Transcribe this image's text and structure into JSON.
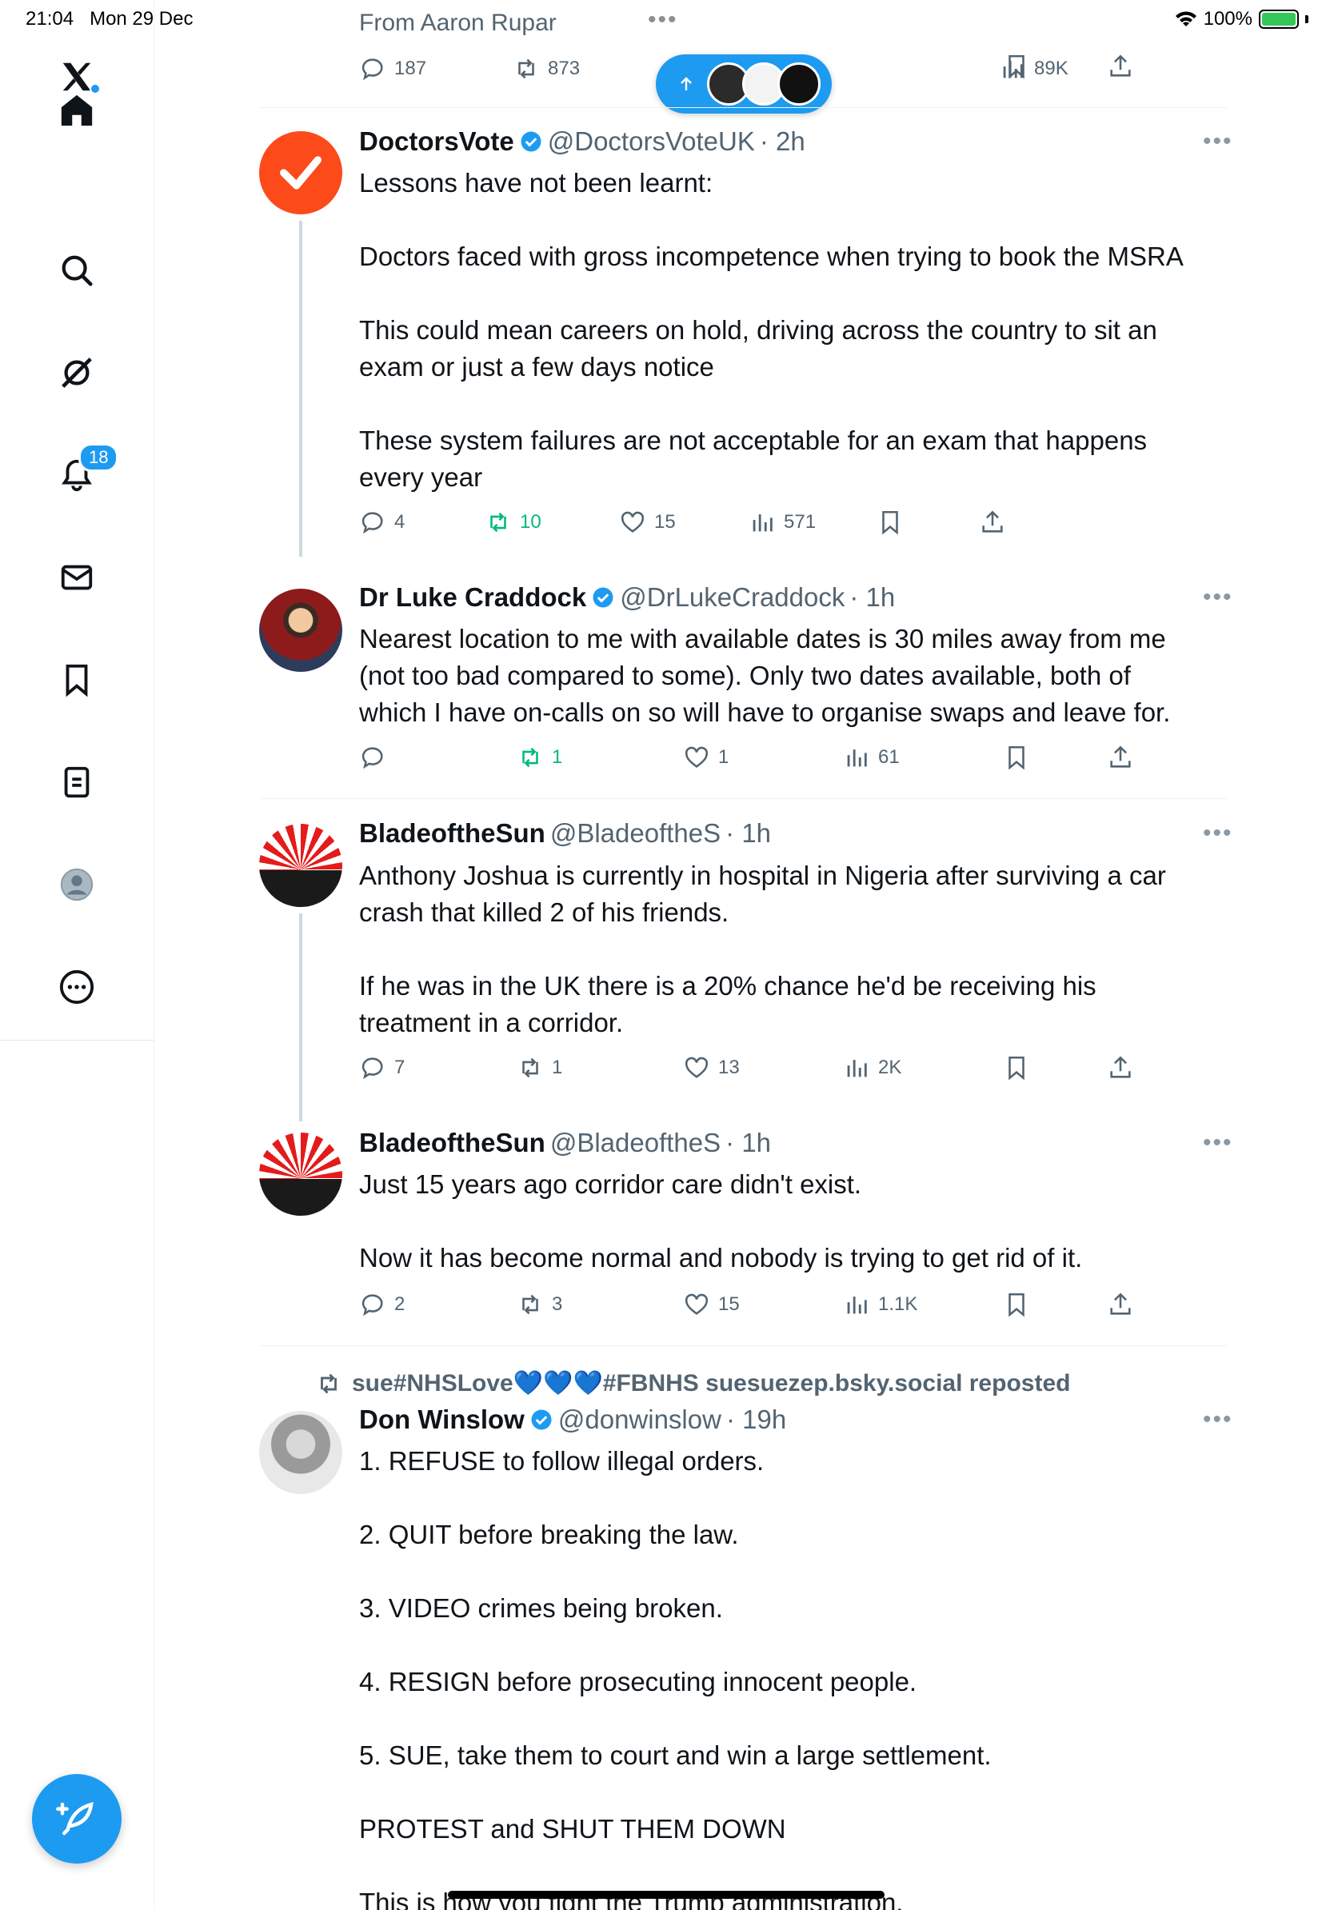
{
  "status_bar": {
    "time": "21:04",
    "date": "Mon 29 Dec",
    "battery": "100%"
  },
  "colors": {
    "accent": "#1d9bf0",
    "repost_active": "#00ba7c",
    "text_secondary": "#536471"
  },
  "sidebar": {
    "logo": "X",
    "items": [
      {
        "icon": "home-icon",
        "label": "Home"
      },
      {
        "icon": "search-icon",
        "label": "Explore"
      },
      {
        "icon": "grok-icon",
        "label": "Grok"
      },
      {
        "icon": "bell-icon",
        "label": "Notifications",
        "badge": "18"
      },
      {
        "icon": "mail-icon",
        "label": "Messages"
      },
      {
        "icon": "bookmark-icon",
        "label": "Bookmarks"
      },
      {
        "icon": "list-icon",
        "label": "Lists"
      },
      {
        "icon": "profile-icon",
        "label": "Profile"
      },
      {
        "icon": "more-icon",
        "label": "More"
      }
    ]
  },
  "top_post": {
    "from_label": "From Aaron Rupar",
    "replies": "187",
    "reposts": "873",
    "views": "89K"
  },
  "tweets": [
    {
      "name": "DoctorsVote",
      "handle": "@DoctorsVoteUK",
      "time": "· 2h",
      "text": [
        "Lessons have not been learnt:",
        "",
        "Doctors faced with gross incompetence when trying to book the MSRA",
        "",
        "This could mean careers on hold, driving across the country to sit an",
        "exam or just a few days notice",
        "",
        "These system failures are not acceptable for an exam that happens",
        "every year"
      ],
      "replies": "4",
      "reposts": "10",
      "likes": "15",
      "views": "571"
    },
    {
      "name": "Dr Luke Craddock",
      "handle": "@DrLukeCraddock",
      "time": "· 1h",
      "text": [
        "Nearest location to me with available dates is 30 miles away from me",
        "(not too bad compared to some). Only two dates available, both of",
        "which I have on-calls on so will have to organise swaps and leave for."
      ],
      "replies": "",
      "reposts": "1",
      "likes": "1",
      "views": "61"
    },
    {
      "name": "BladeoftheSun",
      "handle": "@BladeoftheS",
      "time": "· 1h",
      "text": [
        "Anthony Joshua is currently in hospital in Nigeria after surviving a car",
        "crash that killed 2 of his friends.",
        "",
        "If he was in the UK there is a 20% chance he'd be receiving his",
        "treatment in a corridor."
      ],
      "replies": "7",
      "reposts": "1",
      "likes": "13",
      "views": "2K"
    },
    {
      "name": "BladeoftheSun",
      "handle": "@BladeoftheS",
      "time": "· 1h",
      "text": [
        "Just 15 years ago corridor care didn't exist.",
        "",
        "Now it has become normal and nobody is trying to get rid of it."
      ],
      "replies": "2",
      "reposts": "3",
      "likes": "15",
      "views": "1.1K"
    },
    {
      "repost_by": "sue#NHSLove💙💙💙#FBNHS suesuezep.bsky.social reposted",
      "name": "Don Winslow",
      "handle": "@donwinslow",
      "time": "· 19h",
      "text": [
        "1. REFUSE to follow illegal orders.",
        "",
        "2. QUIT before breaking the law.",
        "",
        "3. VIDEO crimes being broken.",
        "",
        "4. RESIGN before prosecuting innocent people.",
        "",
        "5. SUE, take them to court and win a large settlement.",
        "",
        "PROTEST and SHUT THEM DOWN",
        "",
        "This is how you fight the Trump administration."
      ]
    }
  ]
}
